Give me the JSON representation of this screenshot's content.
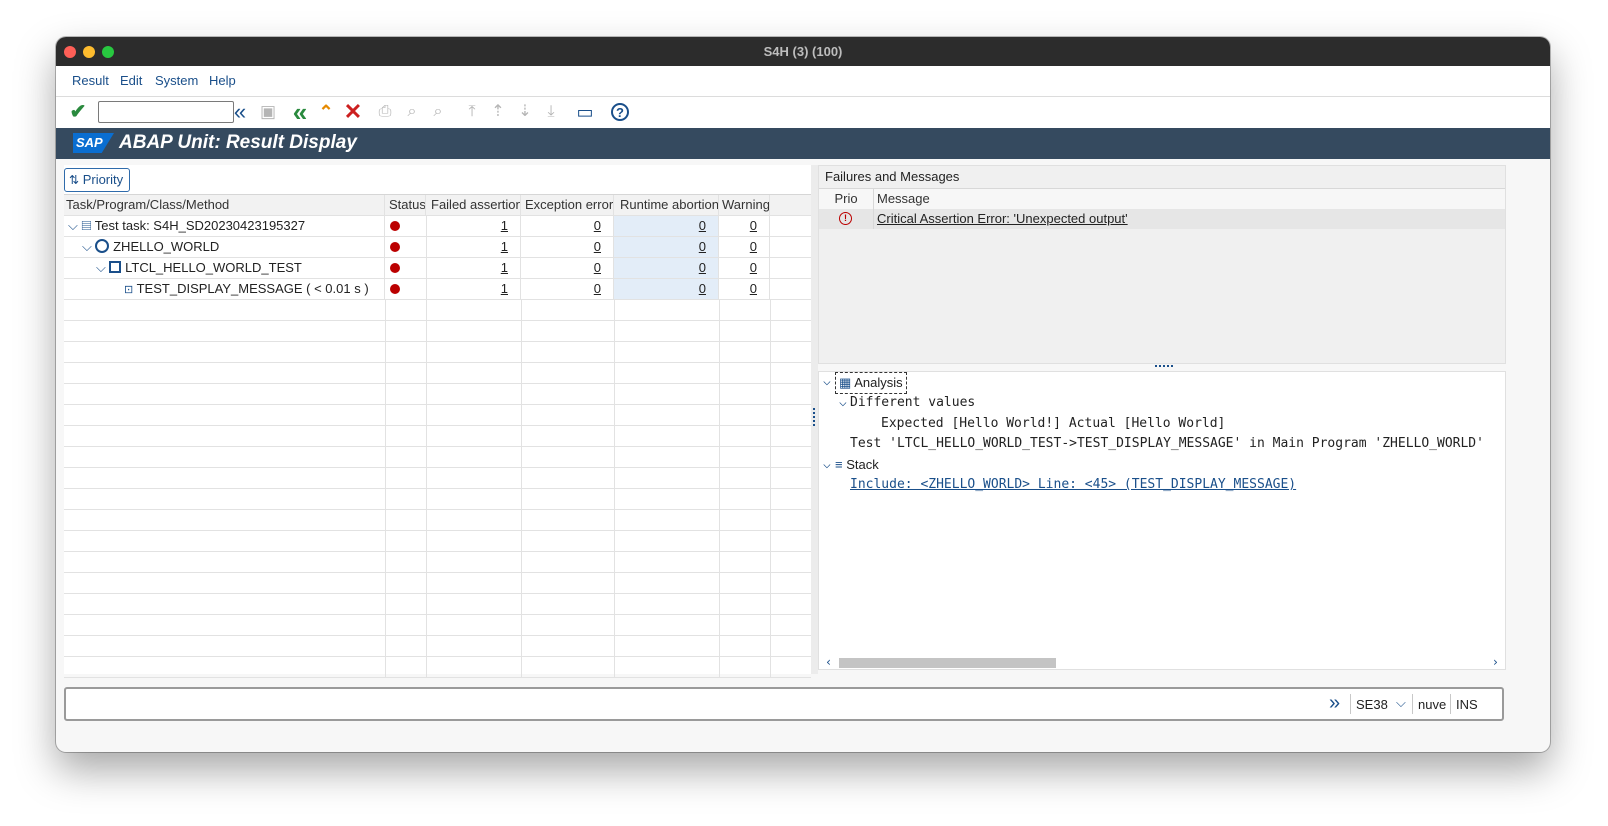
{
  "window": {
    "title": "S4H (3) (100)"
  },
  "menu": {
    "items": [
      "Result",
      "Edit",
      "System",
      "Help"
    ]
  },
  "header": {
    "title": "ABAP Unit: Result Display",
    "logo_text": "SAP"
  },
  "left": {
    "priority_button": "Priority",
    "columns": [
      "Task/Program/Class/Method",
      "Status",
      "Failed assertion",
      "Exception error",
      "Runtime abortion",
      "Warning"
    ],
    "rows": [
      {
        "name": "Test task: S4H_SD20230423195327",
        "failed": "1",
        "exception": "0",
        "runtime": "0",
        "warning": "0"
      },
      {
        "name": "ZHELLO_WORLD",
        "failed": "1",
        "exception": "0",
        "runtime": "0",
        "warning": "0"
      },
      {
        "name": "LTCL_HELLO_WORLD_TEST",
        "failed": "1",
        "exception": "0",
        "runtime": "0",
        "warning": "0"
      },
      {
        "name": "TEST_DISPLAY_MESSAGE ( < 0.01 s )",
        "failed": "1",
        "exception": "0",
        "runtime": "0",
        "warning": "0"
      }
    ]
  },
  "messages": {
    "title": "Failures and Messages",
    "columns": [
      "Prio",
      "Message"
    ],
    "rows": [
      {
        "message": "Critical Assertion Error: 'Unexpected output'"
      }
    ]
  },
  "analysis": {
    "label": "Analysis",
    "diff_label": "Different values",
    "expected_line": "Expected [Hello World!] Actual [Hello World]",
    "test_line": "Test 'LTCL_HELLO_WORLD_TEST->TEST_DISPLAY_MESSAGE' in Main Program 'ZHELLO_WORLD'",
    "stack_label": "Stack",
    "include_line": "Include: <ZHELLO_WORLD> Line: <45> (TEST_DISPLAY_MESSAGE)"
  },
  "status": {
    "transaction": "SE38",
    "server": "nuve",
    "mode": "INS"
  },
  "colors": {
    "accent": "#1a4f8a",
    "header_bg": "#354a5f",
    "error": "#bb0000",
    "ok": "#2a8a3e",
    "nav": "#e68a00",
    "cancel": "#cc1f1f"
  }
}
